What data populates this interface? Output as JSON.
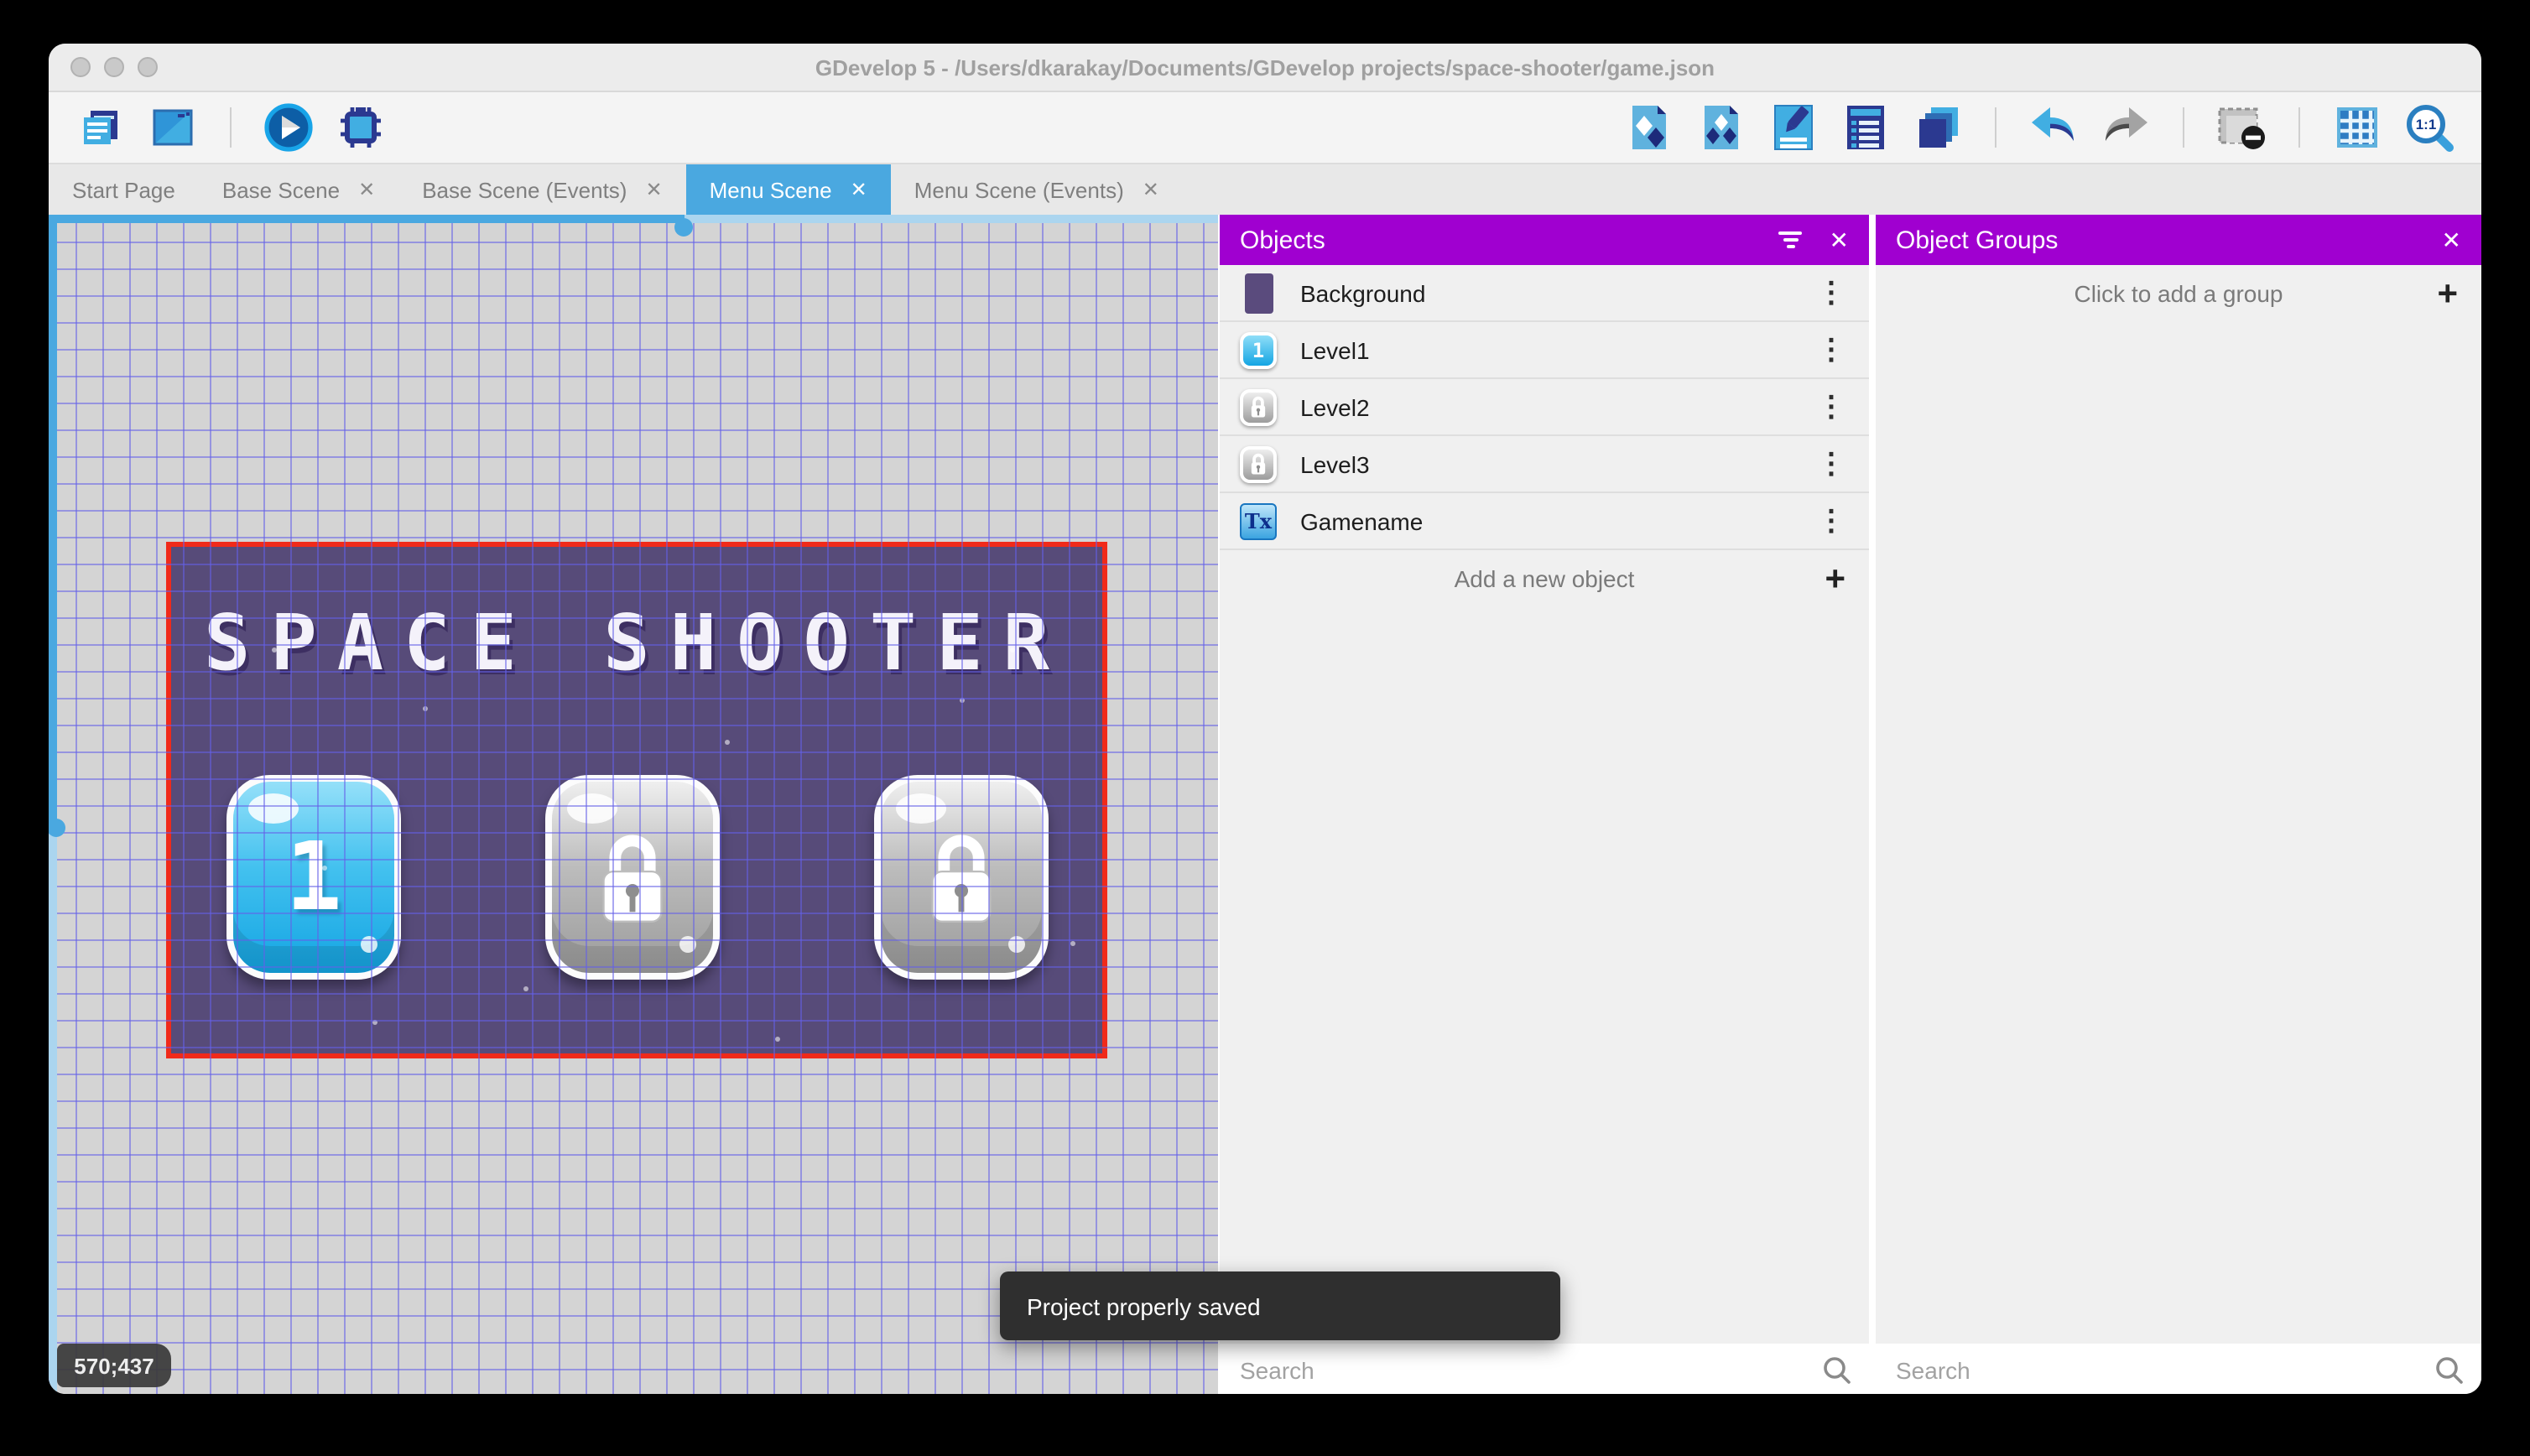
{
  "window": {
    "title": "GDevelop 5 - /Users/dkarakay/Documents/GDevelop projects/space-shooter/game.json"
  },
  "toolbar": {
    "zoom_icon_label": "1:1"
  },
  "tabs": [
    {
      "label": "Start Page",
      "closable": false,
      "active": false
    },
    {
      "label": "Base Scene",
      "closable": true,
      "active": false
    },
    {
      "label": "Base Scene (Events)",
      "closable": true,
      "active": false
    },
    {
      "label": "Menu Scene",
      "closable": true,
      "active": true
    },
    {
      "label": "Menu Scene (Events)",
      "closable": true,
      "active": false
    }
  ],
  "canvas": {
    "scene_title": "SPACE SHOOTER",
    "coordinates": "570;437",
    "level_buttons": [
      {
        "label": "1",
        "state": "unlocked"
      },
      {
        "state": "locked"
      },
      {
        "state": "locked"
      }
    ]
  },
  "objects_panel": {
    "title": "Objects",
    "items": [
      {
        "name": "Background",
        "icon": "background-thumbnail"
      },
      {
        "name": "Level1",
        "icon": "level-button-unlocked",
        "icon_label": "1"
      },
      {
        "name": "Level2",
        "icon": "level-button-locked"
      },
      {
        "name": "Level3",
        "icon": "level-button-locked"
      },
      {
        "name": "Gamename",
        "icon": "text-object",
        "icon_label": "Tx"
      }
    ],
    "add_label": "Add a new object",
    "search_placeholder": "Search"
  },
  "object_groups_panel": {
    "title": "Object Groups",
    "empty_label": "Click to add a group",
    "search_placeholder": "Search"
  },
  "toast": {
    "message": "Project properly saved"
  },
  "icons": {
    "close": "✕",
    "plus": "+",
    "kebab": "⋮"
  },
  "colors": {
    "accent_purple": "#a000d0",
    "active_tab_blue": "#4aa8e0",
    "scene_border_red": "#f02a1a",
    "scene_background": "#574b79",
    "unlocked_blue": "#14a5e3",
    "locked_gray": "#9c9c9c",
    "canvas_gray": "#d4d4d4",
    "grid_line": "#6460e8"
  }
}
